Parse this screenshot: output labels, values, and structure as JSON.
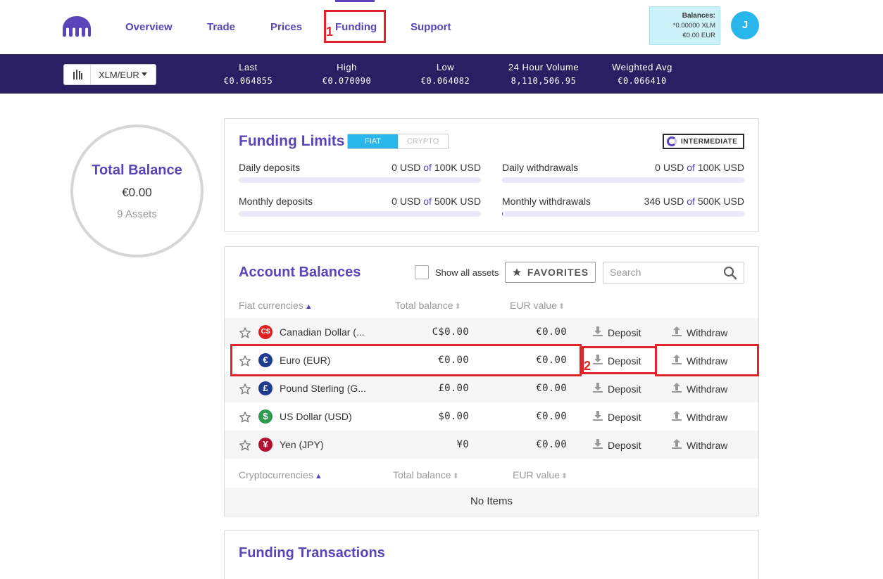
{
  "nav": {
    "items": [
      "Overview",
      "Trade",
      "Prices",
      "Funding",
      "Support"
    ],
    "active": "Funding"
  },
  "balances": {
    "title": "Balances:",
    "xlm": "*0.00000 XLM",
    "eur": "€0.00 EUR"
  },
  "user": {
    "initial": "J"
  },
  "ticker": {
    "pair": "XLM/EUR",
    "stats": [
      {
        "label": "Last",
        "value": "€0.064855"
      },
      {
        "label": "High",
        "value": "€0.070090"
      },
      {
        "label": "Low",
        "value": "€0.064082"
      },
      {
        "label": "24 Hour Volume",
        "value": "8,110,506.95"
      },
      {
        "label": "Weighted Avg",
        "value": "€0.066410"
      }
    ]
  },
  "total_balance": {
    "title": "Total Balance",
    "amount": "€0.00",
    "assets": "9 Assets"
  },
  "funding_limits": {
    "title": "Funding Limits",
    "tabs": [
      "FIAT",
      "CRYPTO"
    ],
    "active_tab": "FIAT",
    "level": "INTERMEDIATE",
    "of_word": "of",
    "limits": [
      {
        "label": "Daily deposits",
        "used": "0 USD",
        "max": "100K USD",
        "fraction": 0
      },
      {
        "label": "Daily withdrawals",
        "used": "0 USD",
        "max": "100K USD",
        "fraction": 0
      },
      {
        "label": "Monthly deposits",
        "used": "0 USD",
        "max": "500K USD",
        "fraction": 0
      },
      {
        "label": "Monthly withdrawals",
        "used": "346 USD",
        "max": "500K USD",
        "fraction": 0.0007
      }
    ]
  },
  "account_balances": {
    "title": "Account Balances",
    "show_all_label": "Show all assets",
    "favorites_label": "FAVORITES",
    "search_placeholder": "Search",
    "fiat_headers": [
      "Fiat currencies",
      "Total balance",
      "EUR value"
    ],
    "crypto_headers": [
      "Cryptocurrencies",
      "Total balance",
      "EUR value"
    ],
    "deposit_label": "Deposit",
    "withdraw_label": "Withdraw",
    "fiat_rows": [
      {
        "symbol": "C$",
        "color": "#e02020",
        "name": "Canadian Dollar (...",
        "total": "C$0.00",
        "eur": "€0.00"
      },
      {
        "symbol": "€",
        "color": "#1f3b8f",
        "name": "Euro (EUR)",
        "total": "€0.00",
        "eur": "€0.00"
      },
      {
        "symbol": "£",
        "color": "#1f3b8f",
        "name": "Pound Sterling (G...",
        "total": "£0.00",
        "eur": "€0.00"
      },
      {
        "symbol": "$",
        "color": "#2e9a4e",
        "name": "US Dollar (USD)",
        "total": "$0.00",
        "eur": "€0.00"
      },
      {
        "symbol": "¥",
        "color": "#b01030",
        "name": "Yen (JPY)",
        "total": "¥0",
        "eur": "€0.00"
      }
    ],
    "no_items": "No Items"
  },
  "funding_transactions": {
    "title": "Funding Transactions"
  },
  "annotations": [
    "1",
    "2"
  ]
}
